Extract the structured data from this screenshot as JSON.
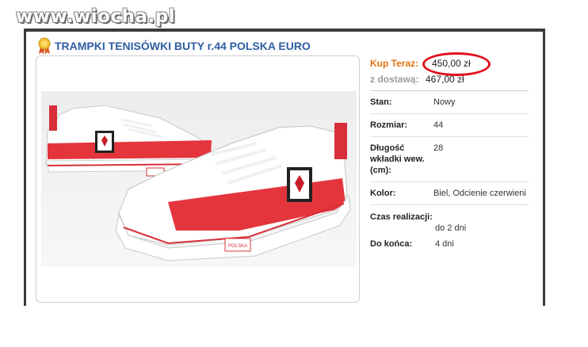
{
  "watermark": "www.wiocha.pl",
  "listing": {
    "title": "TRAMPKI TENISÓWKI BUTY r.44 POLSKA EURO",
    "buy_now_label": "Kup Teraz:",
    "buy_now_price": "450,00 zł",
    "with_shipping_label": "z dostawą:",
    "with_shipping_price": "467,00 zł",
    "shoe_logo_text": "POLSKA"
  },
  "details": [
    {
      "key": "Stan:",
      "value": "Nowy"
    },
    {
      "key": "Rozmiar:",
      "value": "44"
    },
    {
      "key": "Długość wkładki wew. (cm):",
      "value": "28"
    },
    {
      "key": "Kolor:",
      "value": "Biel, Odcienie czerwieni"
    }
  ],
  "delivery": [
    {
      "key": "Czas realizacji:",
      "value": "do 2 dni"
    },
    {
      "key": "Do końca:",
      "value": "4 dni"
    }
  ],
  "colors": {
    "title": "#2f5ea3",
    "buy_label": "#e37212",
    "highlight_ring": "#e0101b"
  },
  "icons": {
    "title_badge": "medal-icon"
  }
}
